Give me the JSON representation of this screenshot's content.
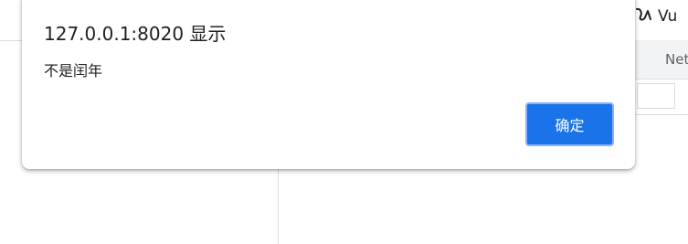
{
  "dialog": {
    "title": "127.0.0.1:8020 显示",
    "message": "不是闰年",
    "ok_label": "确定"
  },
  "background": {
    "extension_icon": "vue-devtools-icon",
    "extension_label": "Vu",
    "devtools_tab_label": "Net"
  },
  "colors": {
    "primary_button": "#1a73e8",
    "button_focus_ring": "#8ab4f8",
    "divider": "#dadce0",
    "text": "#202124"
  }
}
